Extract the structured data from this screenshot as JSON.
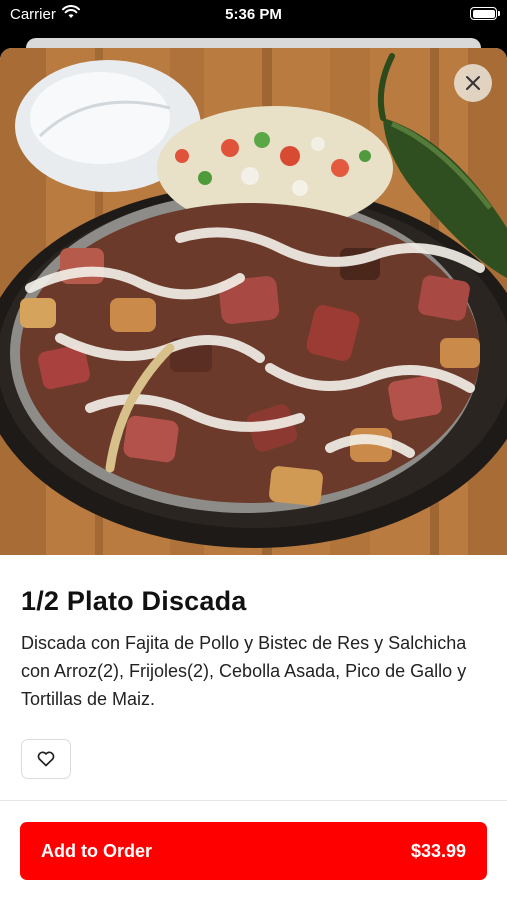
{
  "status_bar": {
    "carrier": "Carrier",
    "time": "5:36 PM"
  },
  "item": {
    "title": "1/2 Plato Discada",
    "description": "Discada con Fajita de Pollo y Bistec de Res y Salchicha con Arroz(2), Frijoles(2), Cebolla Asada, Pico de Gallo y Tortillas de Maiz."
  },
  "order_bar": {
    "add_label": "Add to Order",
    "price": "$33.99"
  },
  "icons": {
    "close": "close-icon",
    "favorite": "heart-icon",
    "wifi": "wifi-icon",
    "battery": "battery-icon"
  },
  "colors": {
    "accent": "#ff0000",
    "title": "#111111",
    "background": "#ffffff"
  }
}
